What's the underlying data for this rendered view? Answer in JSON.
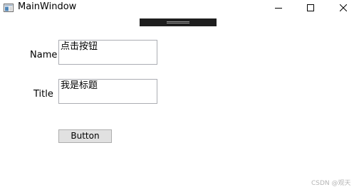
{
  "window": {
    "title": "MainWindow",
    "controls": [
      "minimize-icon",
      "maximize-icon",
      "close-icon"
    ]
  },
  "form": {
    "name_label": "Name",
    "name_value": "点击按钮",
    "title_label": "Title",
    "title_value": "我是标题",
    "button_label": "Button"
  },
  "watermark": "CSDN @观天",
  "colors": {
    "debug_strip": "#1e1e1e",
    "textbox_border": "#abadb3",
    "button_face": "#e1e1e1",
    "button_border": "#adadad"
  }
}
